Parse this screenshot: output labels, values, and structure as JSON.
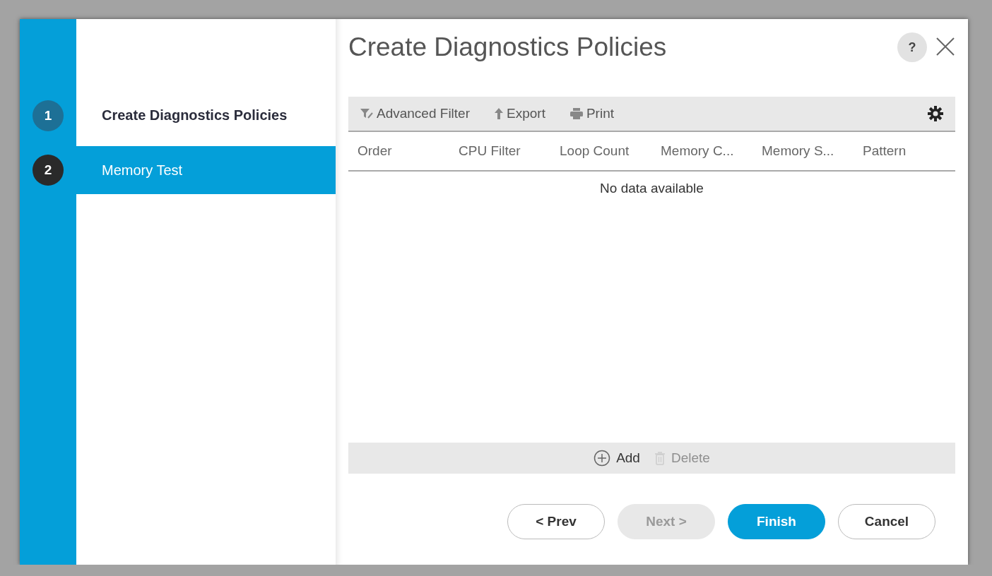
{
  "dialog": {
    "title": "Create Diagnostics Policies",
    "help_label": "?"
  },
  "steps": [
    {
      "number": "1",
      "label": "Create Diagnostics Policies",
      "selected": false
    },
    {
      "number": "2",
      "label": "Memory Test",
      "selected": true
    }
  ],
  "toolbar": [
    {
      "label": "Advanced Filter",
      "kind": "filter"
    },
    {
      "label": "Export",
      "kind": "export"
    },
    {
      "label": "Print",
      "kind": "print"
    }
  ],
  "table": {
    "columns": [
      "Order",
      "CPU Filter",
      "Loop Count",
      "Memory C...",
      "Memory S...",
      "Pattern"
    ],
    "empty_message": "No data available"
  },
  "actions": [
    {
      "label": "Add",
      "kind": "add",
      "disabled": false
    },
    {
      "label": "Delete",
      "kind": "delete",
      "disabled": true
    }
  ],
  "buttons": [
    {
      "label": "< Prev",
      "kind": "secondary",
      "disabled": false
    },
    {
      "label": "Next >",
      "kind": "secondary",
      "disabled": true
    },
    {
      "label": "Finish",
      "kind": "primary",
      "disabled": false
    },
    {
      "label": "Cancel",
      "kind": "secondary",
      "disabled": false
    }
  ]
}
